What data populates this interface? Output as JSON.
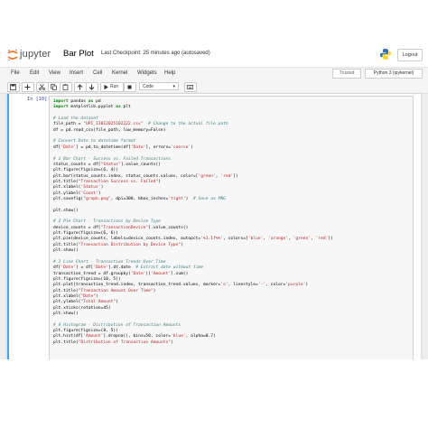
{
  "header": {
    "logo_text": "jupyter",
    "notebook_title": "Bar Plot",
    "checkpoint": "Last Checkpoint: 25 minutes ago  (autosaved)",
    "logout_label": "Logout"
  },
  "menubar": {
    "items": [
      "File",
      "Edit",
      "View",
      "Insert",
      "Cell",
      "Kernel",
      "Widgets",
      "Help"
    ],
    "trusted": "Trusted",
    "kernel": "Python 3 (ipykernel)"
  },
  "toolbar": {
    "run_label": "Run",
    "cell_type": "Code"
  },
  "cell": {
    "prompt": "In [10]:",
    "lines": [
      "import pandas as pd",
      "import matplotlib.pyplot as plt",
      "",
      "# Load the dataset",
      "file_path = \"UPI_13012025102222.csv\"  # Change to the actual file path",
      "df = pd.read_csv(file_path, low_memory=False)",
      "",
      "# Convert Date to datetime format",
      "df['Date'] = pd.to_datetime(df['Date'], errors='coerce')",
      "",
      "# 1 Bar Chart - Success vs. Failed Transactions",
      "status_counts = df[\"Status\"].value_counts()",
      "plt.figure(figsize=(6, 4))",
      "plt.bar(status_counts.index, status_counts.values, color=['green', 'red'])",
      "plt.title(\"Transaction Success vs. Failed\")",
      "plt.xlabel('Status')",
      "plt.ylabel('Count')",
      "plt.savefig(\"graph.png\", dpi=300, bbox_inches='tight')  # Save as PNG",
      "",
      "plt.show()",
      "",
      "# 2 Pie Chart - Transactions by Device Type",
      "device_counts = df[\"TransactionDevice\"].value_counts()",
      "plt.figure(figsize=(6, 6))",
      "plt.pie(device_counts, labels=device_counts.index, autopct='%1.1f%%', colors=['blue', 'orange', 'green', 'red'])",
      "plt.title(\"Transaction Distribution by Device Type\")",
      "plt.show()",
      "",
      "# 3 Line Chart - Transaction Trends Over Time",
      "df['Date'] = df['Date'].dt.date  # Extract date without time",
      "transaction_trend = df.groupby('Date')['Amount'].sum()",
      "plt.figure(figsize=(10, 5))",
      "plt.plot(transaction_trend.index, transaction_trend.values, marker='o', linestyle='-', color='purple')",
      "plt.title(\"Transaction Amount Over Time\")",
      "plt.xlabel(\"Date\")",
      "plt.ylabel(\"Total Amount\")",
      "plt.xticks(rotation=45)",
      "plt.show()",
      "",
      "# 4 Histogram - Distribution of Transaction Amounts",
      "plt.figure(figsize=(8, 5))",
      "plt.hist(df['Amount'].dropna(), bins=50, color='blue', alpha=0.7)",
      "plt.title(\"Distribution of Transaction Amounts\")"
    ]
  },
  "colors": {
    "accent": "#42a5f5",
    "prompt": "#303f9f",
    "keyword": "#008000",
    "comment": "#408080",
    "string": "#ba2121"
  }
}
